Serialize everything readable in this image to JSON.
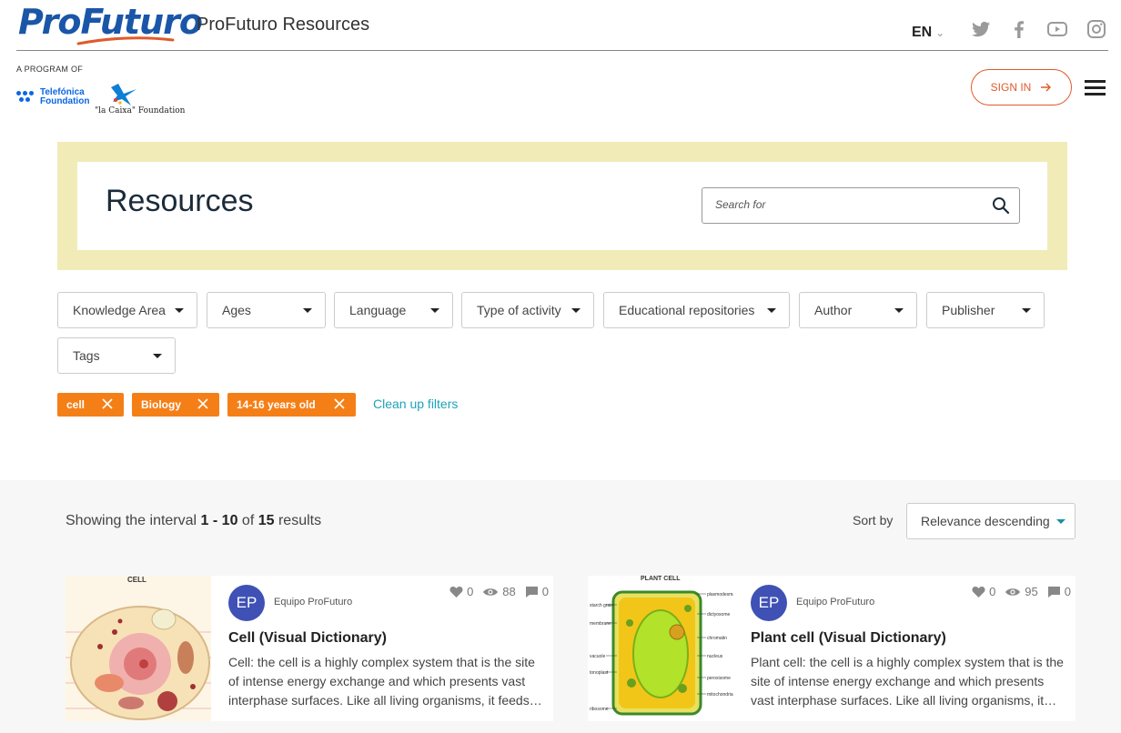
{
  "header": {
    "logo_text": "ProFuturo",
    "site_title": "ProFuturo Resources",
    "language": "EN",
    "program_of": "A PROGRAM OF",
    "telefonica_line1": "Telefónica",
    "telefonica_line2": "Foundation",
    "caixa_text": "\"la Caixa\" Foundation",
    "signin_label": "SIGN IN",
    "social_icons": [
      "twitter-icon",
      "facebook-icon",
      "youtube-icon",
      "instagram-icon"
    ]
  },
  "hero": {
    "title": "Resources",
    "search_placeholder": "Search for"
  },
  "filters": {
    "items": [
      {
        "label": "Knowledge Area"
      },
      {
        "label": "Ages"
      },
      {
        "label": "Language"
      },
      {
        "label": "Type of activity"
      },
      {
        "label": "Educational repositories"
      },
      {
        "label": "Author"
      },
      {
        "label": "Publisher"
      },
      {
        "label": "Tags"
      }
    ]
  },
  "active_filters": {
    "chips": [
      {
        "label": "cell"
      },
      {
        "label": "Biology"
      },
      {
        "label": "14-16 years old"
      }
    ],
    "clear_label": "Clean up filters"
  },
  "results": {
    "prefix": "Showing the interval",
    "range": "1 - 10",
    "of": "of",
    "total": "15",
    "suffix": "results",
    "sort_label": "Sort by",
    "sort_value": "Relevance descending",
    "cards": [
      {
        "image_label": "CELL",
        "avatar": "EP",
        "author": "Equipo ProFuturo",
        "likes": "0",
        "views": "88",
        "comments": "0",
        "title": "Cell (Visual Dictionary)",
        "description": "Cell: the cell is a highly complex system that is the site of intense energy exchange and which presents vast interphase surfaces. Like all living organisms, it feeds…"
      },
      {
        "image_label": "PLANT CELL",
        "avatar": "EP",
        "author": "Equipo ProFuturo",
        "likes": "0",
        "views": "95",
        "comments": "0",
        "title": "Plant cell (Visual Dictionary)",
        "description": "Plant cell: the cell is a highly complex system that is the site of intense energy exchange and which presents vast interphase surfaces. Like all living organisms, it…"
      }
    ]
  },
  "colors": {
    "brand_blue": "#1a56a8",
    "accent_orange": "#f57f17",
    "signin_orange": "#e05a2b",
    "hero_yellow": "#f1ebb8",
    "link_teal": "#1fa3b8",
    "avatar_indigo": "#3f51b5"
  }
}
